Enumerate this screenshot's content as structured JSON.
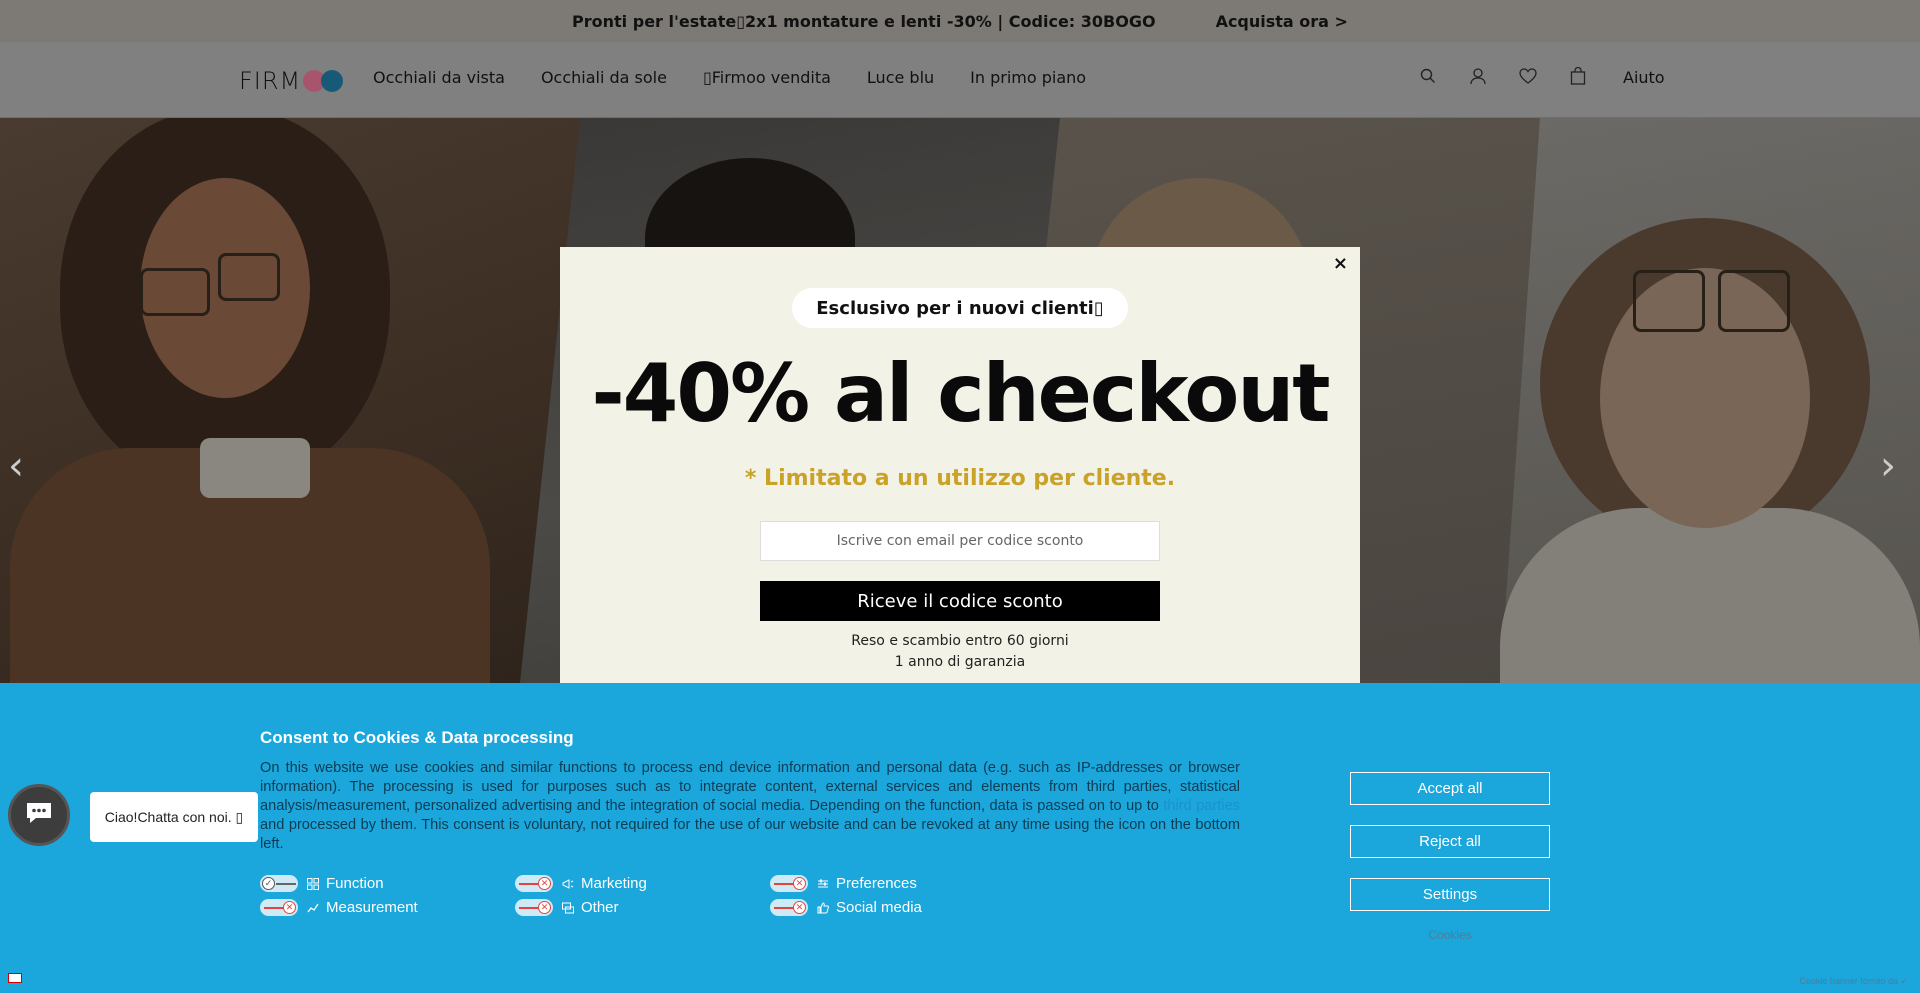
{
  "promo": {
    "text": "Pronti per l'estate▯2x1 montature e  lenti -30% | Codice: 30BOGO",
    "cta": "Acquista ora >"
  },
  "header": {
    "logo_text": "FIRM",
    "nav": [
      "Occhiali da vista",
      "Occhiali da sole",
      "▯Firmoo vendita",
      "Luce blu",
      "In primo piano"
    ],
    "icons": [
      "search-icon",
      "account-icon",
      "heart-icon",
      "bag-icon"
    ],
    "help": "Aiuto"
  },
  "hero": {
    "prev": "‹",
    "next": "›"
  },
  "modal": {
    "close": "×",
    "badge": "Esclusivo per i nuovi clienti▯",
    "headline": "-40% al checkout",
    "subline": "* Limitato a un utilizzo per cliente.",
    "email_placeholder": "Iscrive con email per codice sconto",
    "submit": "Riceve il codice sconto",
    "note1": "Reso e scambio entro 60 giorni",
    "note2": "1 anno di garanzia"
  },
  "cookie": {
    "title": "Consent to Cookies & Data processing",
    "text_before": "On this website we use cookies and similar functions to process end device information and personal data (e.g. such as IP-addresses or browser information). The processing is used for purposes such as to integrate content, external services and elements from third parties, statistical analysis/measurement, personalized advertising and the integration of social media. Depending on the function, data is passed on to up to ",
    "text_link": "third parties",
    "text_after": " and processed by them. This consent is voluntary, not required for the use of our website and can be revoked at any time using the icon on the bottom left.",
    "categories": [
      {
        "label": "Function",
        "on": true,
        "icon": "function-icon"
      },
      {
        "label": "Marketing",
        "on": false,
        "icon": "marketing-icon"
      },
      {
        "label": "Preferences",
        "on": false,
        "icon": "preferences-icon"
      },
      {
        "label": "Measurement",
        "on": false,
        "icon": "measurement-icon"
      },
      {
        "label": "Other",
        "on": false,
        "icon": "other-icon"
      },
      {
        "label": "Social media",
        "on": false,
        "icon": "social-media-icon"
      }
    ],
    "accept": "Accept all",
    "reject": "Reject all",
    "settings": "Settings",
    "cookies_link": "Cookies",
    "powered": "Cookie banner fornito da ✓"
  },
  "chat": {
    "bubble": "Ciao!Chatta con noi. ▯"
  },
  "colors": {
    "cookie_bg": "#1ba6dc",
    "accent_gold": "#c9a227"
  }
}
